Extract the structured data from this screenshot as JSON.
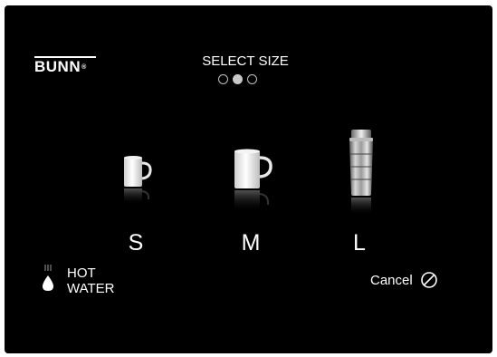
{
  "brand": {
    "name": "BUNN",
    "mark": "®"
  },
  "header": {
    "title": "SELECT SIZE",
    "step_count": 3,
    "active_step": 2
  },
  "sizes": [
    {
      "label": "S",
      "icon": "small-mug-icon"
    },
    {
      "label": "M",
      "icon": "medium-mug-icon"
    },
    {
      "label": "L",
      "icon": "travel-mug-icon"
    }
  ],
  "hot_water": {
    "line1": "HOT",
    "line2": "WATER",
    "icon": "water-drop-icon"
  },
  "cancel": {
    "label": "Cancel",
    "icon": "cancel-icon"
  },
  "colors": {
    "background": "#000000",
    "text": "#ffffff",
    "active_dot": "#c8c8c8"
  }
}
